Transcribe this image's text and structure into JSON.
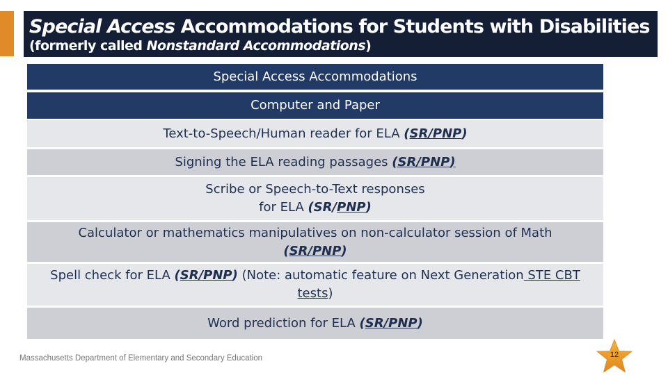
{
  "slide": {
    "title": {
      "line1_italic": "Special Access",
      "line1_rest": " Accommodations for Students with Disabilities",
      "line2_prefix": "(formerly called ",
      "line2_italic": "Nonstandard Accommodations",
      "line2_suffix": ")"
    },
    "table": {
      "header": "Special Access Accommodations",
      "subheader": "Computer and Paper",
      "rows": [
        {
          "text": "Text-to-Speech/Human reader for ELA ",
          "tag_open": "(",
          "tag_sr": "SR/PNP",
          "tag_close": ")"
        },
        {
          "text": "Signing the ELA reading passages ",
          "tag_open": "(",
          "tag_sr": "SR/PNP",
          "tag_close": ")"
        },
        {
          "text_line1": "Scribe or Speech-to-Text responses",
          "text_line2": "for ELA ",
          "tag_open": "(",
          "tag_sr": "SR/",
          "tag_pnp": "PNP",
          "tag_close": ")"
        },
        {
          "text_line1": "Calculator or mathematics manipulatives on non-calculator session of Math",
          "tag_open": "(",
          "tag_sr": "SR/PNP",
          "tag_close": ")"
        },
        {
          "text": "Spell check for ELA ",
          "tag_open": "(",
          "tag_sr": "SR/PNP",
          "tag_close": ")",
          "note_prefix": " (Note: automatic feature on Next Generation",
          "note_link1": " STE CBT",
          "note_link2": "tests",
          "note_suffix": ")"
        },
        {
          "text": "Word prediction for ELA ",
          "tag_open": "(",
          "tag_sr": "SR/PNP",
          "tag_close": ")"
        }
      ]
    },
    "footer": "Massachusetts Department of Elementary and Secondary Education",
    "page_number": "12",
    "colors": {
      "accent": "#e08a2a",
      "title_bg": "#141f36",
      "header_bg": "#213a66",
      "row_light": "#e5e7eb",
      "row_dark": "#cdcfd4",
      "text": "#1f2f50"
    }
  }
}
